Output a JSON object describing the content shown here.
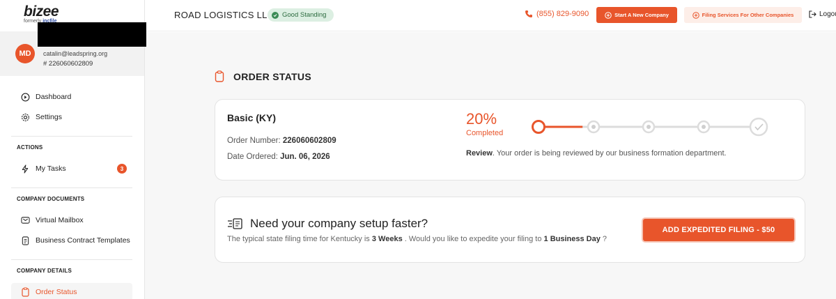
{
  "brand": {
    "logo_text": "bizee",
    "formerly_prefix": "formerly",
    "formerly_name": "incfile"
  },
  "user": {
    "initials": "MD",
    "email": "catalin@leadspring.org",
    "id_text": "# 226060602809"
  },
  "sidebar": {
    "dashboard": "Dashboard",
    "settings": "Settings",
    "actions_header": "ACTIONS",
    "my_tasks": "My Tasks",
    "tasks_count": "3",
    "company_documents_header": "COMPANY DOCUMENTS",
    "virtual_mailbox": "Virtual Mailbox",
    "contract_templates": "Business Contract Templates",
    "company_details_header": "COMPANY DETAILS",
    "order_status": "Order Status"
  },
  "header": {
    "company_name": "ROAD LOGISTICS LLC",
    "standing": "Good Standing",
    "phone": "(855) 829-9090",
    "start_new_company": "Start A New Company",
    "filing_services": "Filing Services For Other Companies",
    "logout": "Logout"
  },
  "order": {
    "page_title": "ORDER STATUS",
    "plan": "Basic (KY)",
    "order_number_label": "Order Number:",
    "order_number": "226060602809",
    "date_label": "Date Ordered:",
    "date": "Jun. 06, 2026",
    "percent": "20%",
    "percent_label": "Completed",
    "progress_fraction": 0.2,
    "steps_total": 5,
    "current_step": 1,
    "review_title": "Review",
    "review_text": ". Your order is being reviewed by our business formation department."
  },
  "expedite": {
    "title": "Need your company setup faster?",
    "sub_prefix": "The typical state filing time for Kentucky is",
    "sub_weeks": "3 Weeks",
    "sub_middle": ". Would you like to expedite your filing to",
    "sub_day": "1 Business Day",
    "sub_suffix": "?",
    "button": "ADD EXPEDITED FILING - $50"
  },
  "colors": {
    "accent": "#e8552b",
    "standing_bg": "#dcefe2",
    "standing_text": "#2c6b3f"
  }
}
